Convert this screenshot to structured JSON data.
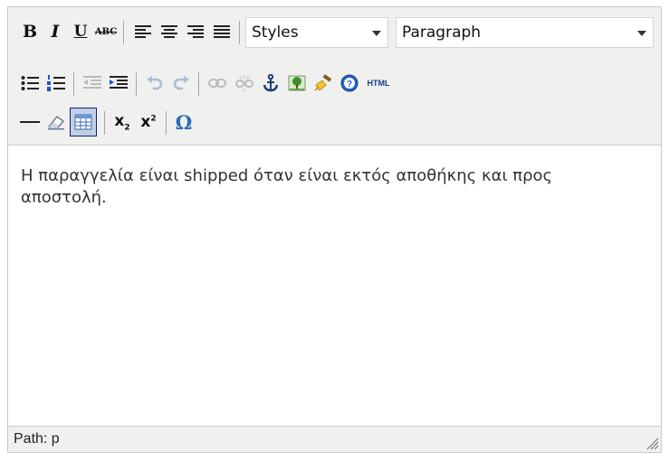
{
  "toolbar": {
    "row1": {
      "bold": "B",
      "italic": "I",
      "underline": "U",
      "strikethrough": "ABC",
      "styles_select": "Styles",
      "format_select": "Paragraph"
    },
    "row2": {
      "html_button": "HTML"
    },
    "row3": {
      "subscript_label": "x",
      "superscript_label": "x",
      "omega": "Ω"
    }
  },
  "content": {
    "text": "Η παραγγελία είναι shipped όταν είναι εκτός αποθήκης και προς αποστολή."
  },
  "status": {
    "path": "Path: p"
  },
  "colors": {
    "toolbar_bg": "#f0f0ee",
    "border": "#c9c9c9",
    "icon_blue": "#2b6cb0",
    "separator": "#a6a6a6"
  }
}
